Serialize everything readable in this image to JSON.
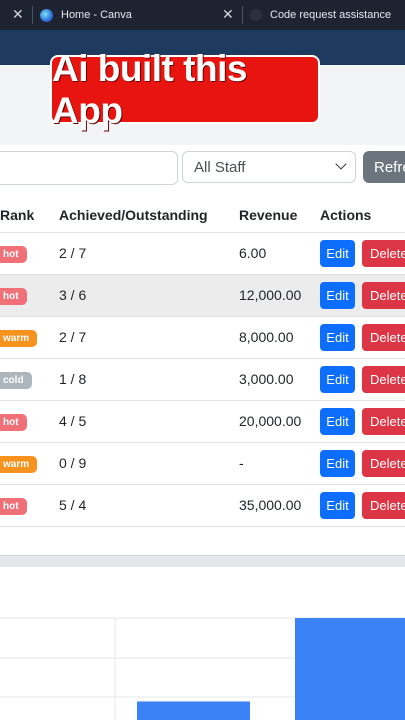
{
  "browser": {
    "tabs": [
      {
        "title": "Home - Canva",
        "icon": "canva-icon"
      },
      {
        "title": "Code request assistance",
        "icon": "tab-favicon-icon"
      }
    ]
  },
  "overlay_caption": "Ai built this App",
  "filters": {
    "search_placeholder": "",
    "staff_select": "All Staff",
    "refresh_label": "Refre"
  },
  "table": {
    "headers": {
      "rank": "Rank",
      "achieved": "Achieved/Outstanding",
      "revenue": "Revenue",
      "actions": "Actions"
    },
    "edit_label": "Edit",
    "delete_label": "Delete",
    "rows": [
      {
        "rank": "hot",
        "achieved": "2 / 7",
        "revenue": "6.00"
      },
      {
        "rank": "hot",
        "achieved": "3 / 6",
        "revenue": "12,000.00"
      },
      {
        "rank": "warm",
        "achieved": "2 / 7",
        "revenue": "8,000.00"
      },
      {
        "rank": "cold",
        "achieved": "1 / 8",
        "revenue": "3,000.00"
      },
      {
        "rank": "hot",
        "achieved": "4 / 5",
        "revenue": "20,000.00"
      },
      {
        "rank": "warm",
        "achieved": "0 / 9",
        "revenue": "-"
      },
      {
        "rank": "hot",
        "achieved": "5 / 4",
        "revenue": "35,000.00"
      }
    ]
  },
  "colors": {
    "hot": "#f07078",
    "warm": "#f7921e",
    "cold": "#adb5bd",
    "edit": "#0d6efd",
    "delete": "#dc3545",
    "bar": "#3b82f6"
  },
  "chart_data": {
    "type": "bar",
    "visible_bar_heights_relative": [
      0.18,
      0.99
    ]
  }
}
